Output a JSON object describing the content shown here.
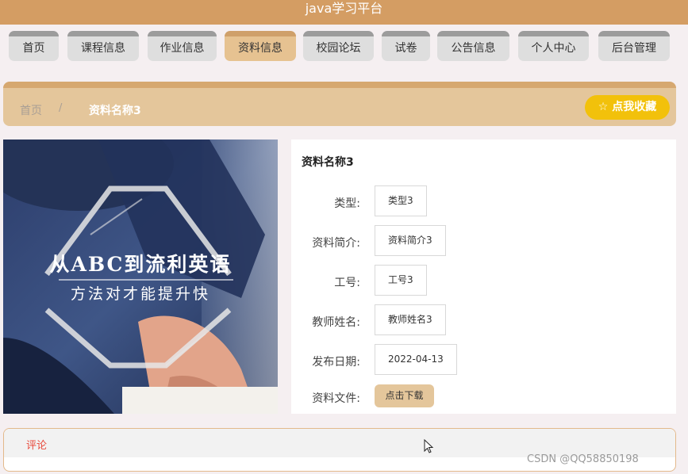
{
  "app": {
    "title": "java学习平台"
  },
  "nav": {
    "items": [
      {
        "label": "首页"
      },
      {
        "label": "课程信息"
      },
      {
        "label": "作业信息"
      },
      {
        "label": "资料信息",
        "active": true
      },
      {
        "label": "校园论坛"
      },
      {
        "label": "试卷"
      },
      {
        "label": "公告信息"
      },
      {
        "label": "个人中心"
      },
      {
        "label": "后台管理"
      }
    ]
  },
  "breadcrumb": {
    "home": "首页",
    "separator": "/",
    "current": "资料名称3",
    "favorite_button": "☆ 点我收藏"
  },
  "cover": {
    "title_line": "从ABC到流利英语",
    "subtitle_line": "方法对才能提升快"
  },
  "detail": {
    "title": "资料名称3",
    "fields": [
      {
        "label": "类型:",
        "value": "类型3"
      },
      {
        "label": "资料简介:",
        "value": "资料简介3"
      },
      {
        "label": "工号:",
        "value": "工号3"
      },
      {
        "label": "教师姓名:",
        "value": "教师姓名3"
      },
      {
        "label": "发布日期:",
        "value": "2022-04-13"
      }
    ],
    "file_label": "资料文件:",
    "download_button": "点击下载"
  },
  "comment": {
    "tab": "评论"
  },
  "watermark": "CSDN @QQ58850198",
  "colors": {
    "brand": "#d49d63",
    "accent_light": "#e4c69b",
    "favorite": "#f2c10b",
    "comment_tab": "#e84a3c"
  }
}
